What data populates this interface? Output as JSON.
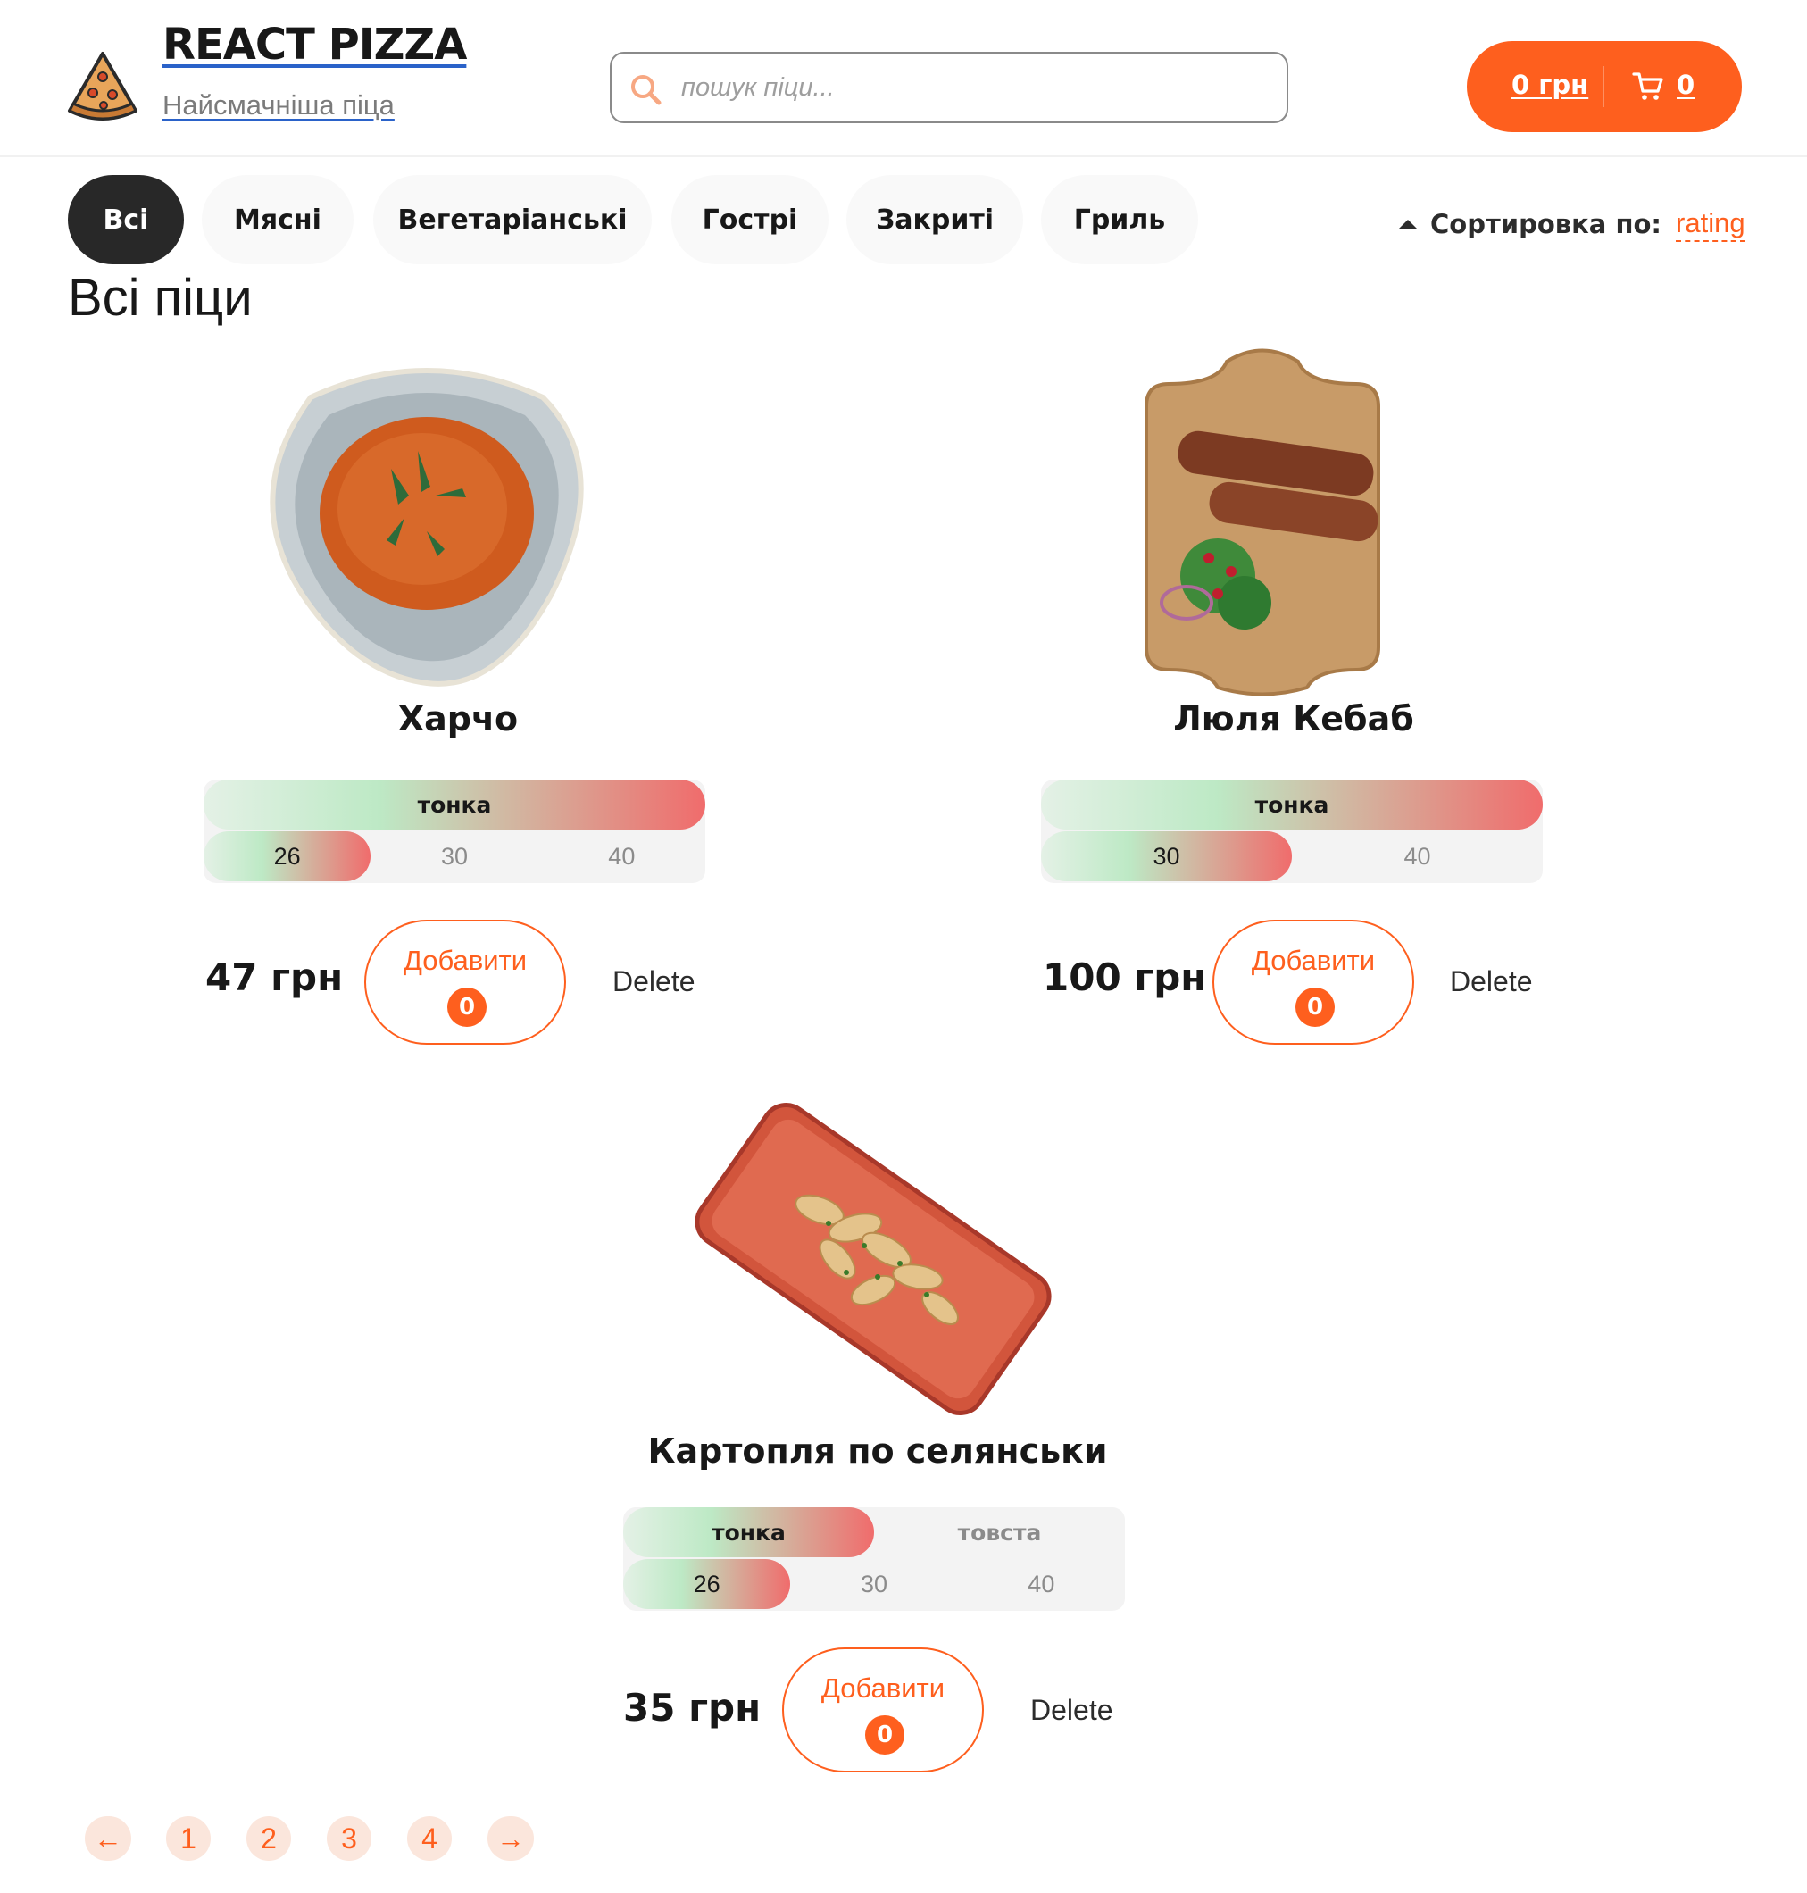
{
  "header": {
    "logo_icon": "pizza-slice-icon",
    "title": "REACT PIZZA",
    "subtitle": "Найсмачніша піца",
    "search": {
      "placeholder": "пошук піци...",
      "value": "",
      "icon": "search-icon"
    },
    "cart": {
      "price": "0 грн",
      "count": "0",
      "icon": "cart-icon"
    }
  },
  "categories": [
    "Всі",
    "Мясні",
    "Вегетаріанські",
    "Гострі",
    "Закриті",
    "Гриль"
  ],
  "active_category": "Всі",
  "sort": {
    "label": "Сортировка по:",
    "value": "rating"
  },
  "page_title": "Всі піци",
  "products": [
    {
      "title": "Харчо",
      "types": [
        "тонка"
      ],
      "active_type": "тонка",
      "sizes": [
        "26",
        "30",
        "40"
      ],
      "active_size": "26",
      "price": "47 грн",
      "add_label": "Добавити",
      "add_count": "0",
      "delete_label": "Delete"
    },
    {
      "title": "Люля Кебаб",
      "types": [
        "тонка"
      ],
      "active_type": "тонка",
      "sizes": [
        "30",
        "40"
      ],
      "active_size": "30",
      "price": "100 грн",
      "add_label": "Добавити",
      "add_count": "0",
      "delete_label": "Delete"
    },
    {
      "title": "Картопля по селянськи",
      "types": [
        "тонка",
        "товста"
      ],
      "active_type": "тонка",
      "sizes": [
        "26",
        "30",
        "40"
      ],
      "active_size": "26",
      "price": "35 грн",
      "add_label": "Добавити",
      "add_count": "0",
      "delete_label": "Delete"
    }
  ],
  "pagination": {
    "prev": "←",
    "pages": [
      "1",
      "2",
      "3",
      "4"
    ],
    "next": "→"
  },
  "colors": {
    "accent": "#fe5f1e",
    "dark": "#282828",
    "chip_bg": "#f9f9f9",
    "selector_bg": "#f3f3f3"
  }
}
